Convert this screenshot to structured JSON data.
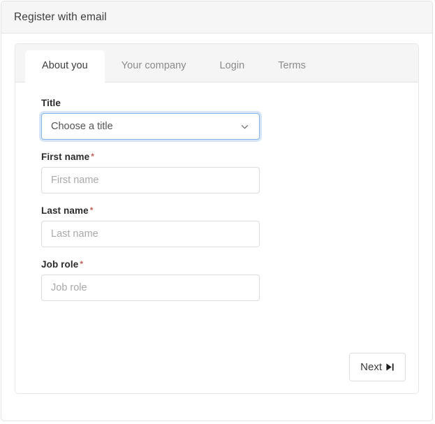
{
  "window": {
    "title": "Register with email"
  },
  "tabs": [
    {
      "label": "About you",
      "active": true
    },
    {
      "label": "Your company",
      "active": false
    },
    {
      "label": "Login",
      "active": false
    },
    {
      "label": "Terms",
      "active": false
    }
  ],
  "form": {
    "title_field": {
      "label": "Title",
      "required": false,
      "value": "Choose a title",
      "icon": "chevron-down-icon",
      "focused": true
    },
    "first_name_field": {
      "label": "First name",
      "required_marker": "*",
      "value": "",
      "placeholder": "First name"
    },
    "last_name_field": {
      "label": "Last name",
      "required_marker": "*",
      "value": "",
      "placeholder": "Last name"
    },
    "job_role_field": {
      "label": "Job role",
      "required_marker": "*",
      "value": "",
      "placeholder": "Job role"
    }
  },
  "footer": {
    "next_label": "Next",
    "next_icon": "skip-forward-icon"
  },
  "colors": {
    "header_bg": "#f6f6f6",
    "tab_strip_bg": "#f5f5f5",
    "focus_ring": "#86b7e8",
    "required_star": "#c0615b",
    "text_primary": "#3c3c3c",
    "text_muted": "#8b8b8b",
    "placeholder": "#a9a9a9",
    "border": "#e3e3e3"
  }
}
